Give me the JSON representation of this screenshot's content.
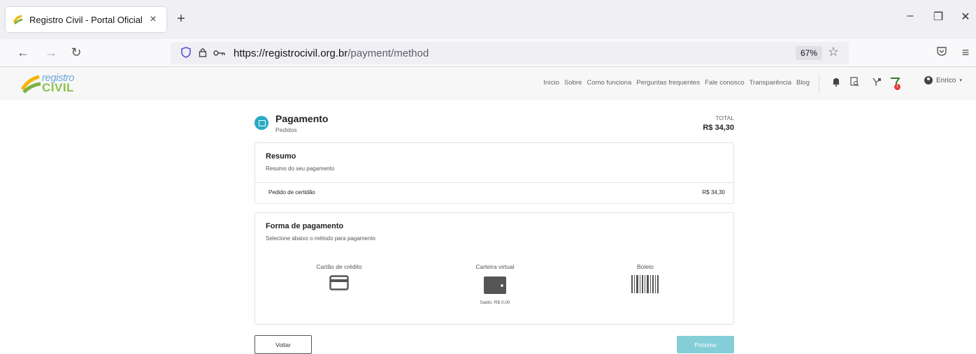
{
  "browser": {
    "tab_title": "Registro Civil - Portal Oficial",
    "tab_close": "×",
    "new_tab": "+",
    "url_host": "https://registrocivil.org.br",
    "url_path": "/payment/method",
    "zoom": "67%"
  },
  "site": {
    "logo_line1": "registro",
    "logo_line2": "CIVIL",
    "nav": [
      "Início",
      "Sobre",
      "Como funciona",
      "Perguntas frequentes",
      "Fale conosco",
      "Transparência",
      "Blog"
    ],
    "cart_count": "1",
    "user_name": "Enrico"
  },
  "payment": {
    "title": "Pagamento",
    "subtitle": "Pedidos",
    "total_label": "TOTAL",
    "total_value": "R$ 34,30"
  },
  "summary": {
    "title": "Resumo",
    "subtitle": "Resumo do seu pagamento",
    "item_label": "Pedido de certidão",
    "item_value": "R$ 34,30"
  },
  "method": {
    "title": "Forma de pagamento",
    "subtitle": "Selecione abaixo o método para pagamento",
    "options": [
      {
        "label": "Cartão de crédito"
      },
      {
        "label": "Carteira virtual",
        "saldo": "Saldo: R$ 0,00"
      },
      {
        "label": "Boleto"
      }
    ]
  },
  "actions": {
    "back": "Voltar",
    "next": "Próximo"
  },
  "colors": {
    "accent": "#2aaac4",
    "next_button": "#84cfd7",
    "badge": "#e53935"
  }
}
